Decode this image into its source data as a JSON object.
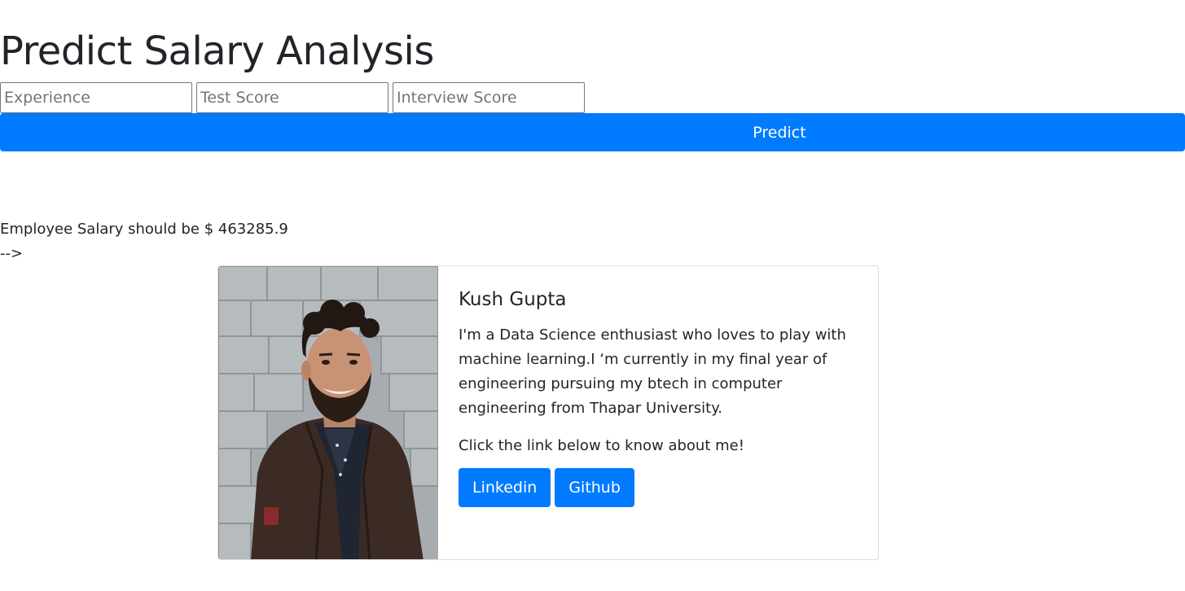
{
  "header": {
    "title": "Predict Salary Analysis"
  },
  "form": {
    "experience_placeholder": "Experience",
    "test_score_placeholder": "Test Score",
    "interview_score_placeholder": "Interview Score",
    "submit_label": "Predict"
  },
  "result": {
    "text": "Employee Salary should be $ 463285.9",
    "stray_text": "-->"
  },
  "profile": {
    "name": "Kush Gupta",
    "bio": "I'm a Data Science enthusiast who loves to play with machine learning.I ‘m currently in my final year of engineering pursuing my btech in computer engineering from Thapar University.",
    "cta": "Click the link below to know about me!",
    "linkedin_label": "Linkedin",
    "github_label": "Github"
  },
  "colors": {
    "accent": "#007bff",
    "text": "#212529",
    "card_border": "#dfdfdf"
  }
}
